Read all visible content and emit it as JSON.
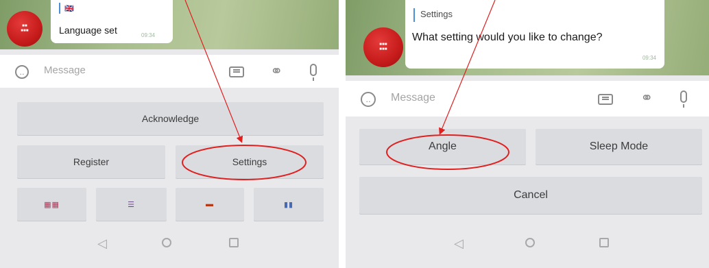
{
  "left": {
    "chat": {
      "reply_flag": "🇬🇧",
      "message_text": "Language set",
      "message_time": "09:34"
    },
    "input": {
      "placeholder": "Message",
      "emoji_icon": "smiley-icon",
      "keyboard_icon": "keyboard-icon",
      "attach_icon": "paperclip-icon",
      "mic_icon": "microphone-icon"
    },
    "keyboard": {
      "acknowledge": "Acknowledge",
      "register": "Register",
      "settings": "Settings",
      "flags": [
        {
          "icon": "flag-uk-icon",
          "glyph": "▦▦"
        },
        {
          "icon": "flag-nl-icon",
          "glyph": "☰"
        },
        {
          "icon": "flag-de-icon",
          "glyph": "▬"
        },
        {
          "icon": "flag-fr-icon",
          "glyph": "▮▮"
        }
      ]
    }
  },
  "right": {
    "chat": {
      "reply_title": "Settings",
      "message_text": "What setting would you like to change?",
      "message_time": "09:34"
    },
    "input": {
      "placeholder": "Message"
    },
    "keyboard": {
      "angle": "Angle",
      "sleep_mode": "Sleep Mode",
      "cancel": "Cancel"
    }
  },
  "annotation_color": "#e01f1f",
  "nav": {
    "back": "◁",
    "home": "○",
    "recent": "□"
  }
}
